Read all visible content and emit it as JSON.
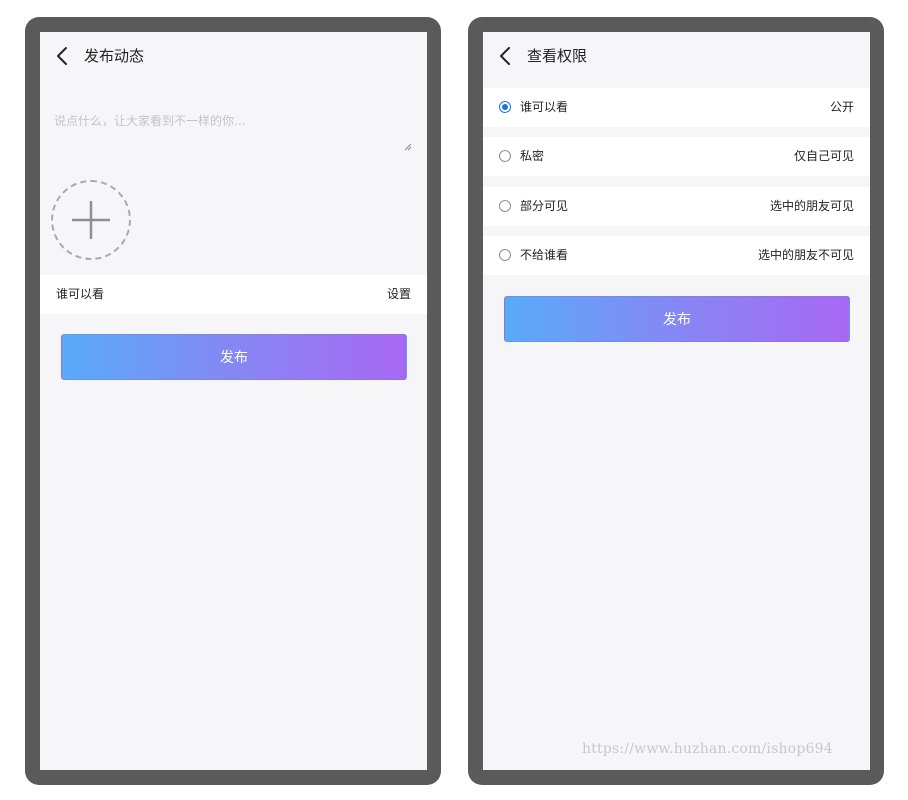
{
  "left_screen": {
    "header": {
      "title": "发布动态"
    },
    "post_input": {
      "placeholder": "说点什么，让大家看到不一样的你..."
    },
    "visibility_row": {
      "label": "谁可以看",
      "value": "设置"
    },
    "publish_label": "发布"
  },
  "right_screen": {
    "header": {
      "title": "查看权限"
    },
    "options": [
      {
        "label": "谁可以看",
        "desc": "公开",
        "selected": true
      },
      {
        "label": "私密",
        "desc": "仅自己可见",
        "selected": false
      },
      {
        "label": "部分可见",
        "desc": "选中的朋友可见",
        "selected": false
      },
      {
        "label": "不给谁看",
        "desc": "选中的朋友不可见",
        "selected": false
      }
    ],
    "publish_label": "发布"
  },
  "watermark": "https://www.huzhan.com/ishop694",
  "colors": {
    "accent_blue": "#1a73e8",
    "gradient_start": "#59abf8",
    "gradient_end": "#a868f3",
    "frame": "#5a5a5a"
  }
}
